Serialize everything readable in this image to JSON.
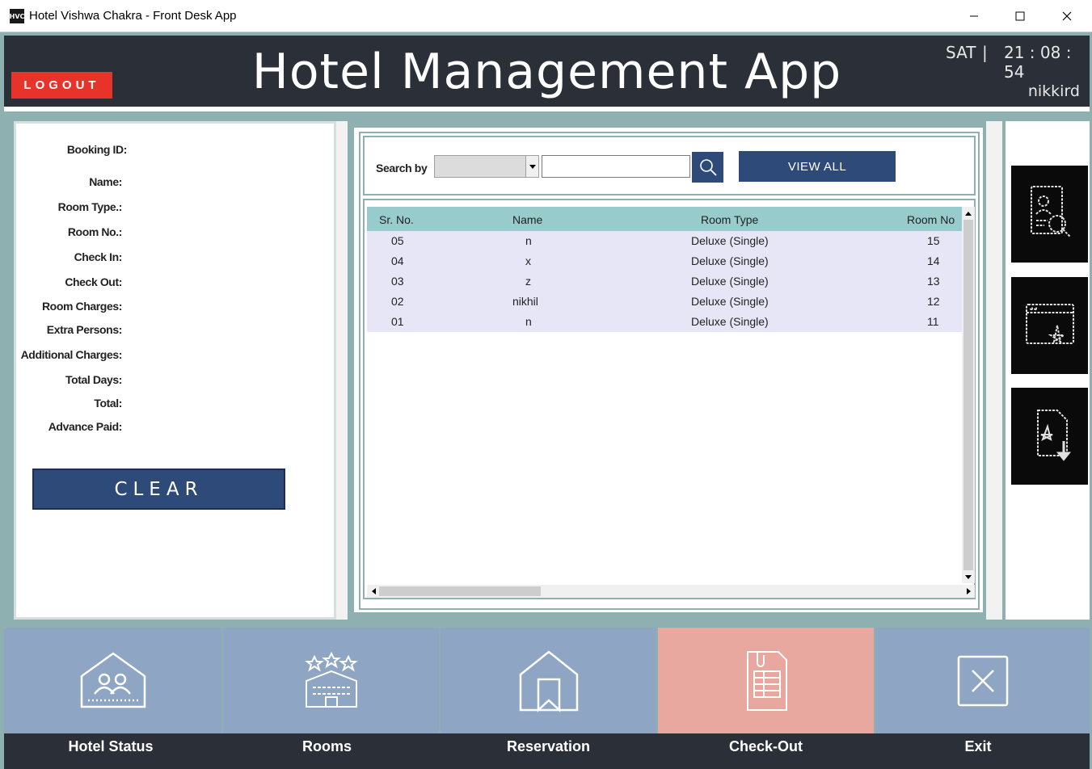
{
  "window": {
    "title": "Hotel Vishwa Chakra - Front Desk App",
    "icon_text": "HVC"
  },
  "header": {
    "logout_label": "LOGOUT",
    "app_title": "Hotel Management App",
    "day": "SAT",
    "separator": "|",
    "time": "21 : 08 : 54",
    "username": "nikkird"
  },
  "details": {
    "fields": [
      "Booking ID:",
      "Name:",
      "Room Type.:",
      "Room No.:",
      "Check In:",
      "Check Out:",
      "Room Charges:",
      "Extra Persons:",
      "Additional Charges:",
      "Total Days:",
      "Total:",
      "Advance Paid:"
    ],
    "clear_label": "CLEAR"
  },
  "search": {
    "label": "Search by",
    "selected_option": "",
    "input_value": "",
    "view_all_label": "VIEW ALL"
  },
  "table": {
    "columns": [
      "Sr. No.",
      "Name",
      "Room Type",
      "Room No"
    ],
    "rows": [
      [
        "05",
        "n",
        "Deluxe (Single)",
        "15"
      ],
      [
        "04",
        "x",
        "Deluxe (Single)",
        "14"
      ],
      [
        "03",
        "z",
        "Deluxe (Single)",
        "13"
      ],
      [
        "02",
        "nikhil",
        "Deluxe (Single)",
        "12"
      ],
      [
        "01",
        "n",
        "Deluxe (Single)",
        "11"
      ]
    ]
  },
  "side_actions": {
    "icons": [
      "search-document-icon",
      "window-pdf-icon",
      "pdf-download-icon"
    ]
  },
  "nav": {
    "items": [
      {
        "label": "Hotel Status",
        "icon": "hotel-guests-icon"
      },
      {
        "label": "Rooms",
        "icon": "hotel-building-icon"
      },
      {
        "label": "Reservation",
        "icon": "bookmark-house-icon"
      },
      {
        "label": "Check-Out",
        "icon": "invoice-document-icon"
      },
      {
        "label": "Exit",
        "icon": "close-box-icon"
      }
    ],
    "active": "Check-Out"
  },
  "colors": {
    "header_bg": "#2b2f38",
    "accent_blue": "#2e4a78",
    "logout_red": "#e8332a",
    "nav_tile": "#8ea5c4",
    "nav_active": "#e8a89f",
    "table_header": "#98cccc",
    "row_bg": "#e6e6f7",
    "frame_teal": "#8fb0b0"
  }
}
